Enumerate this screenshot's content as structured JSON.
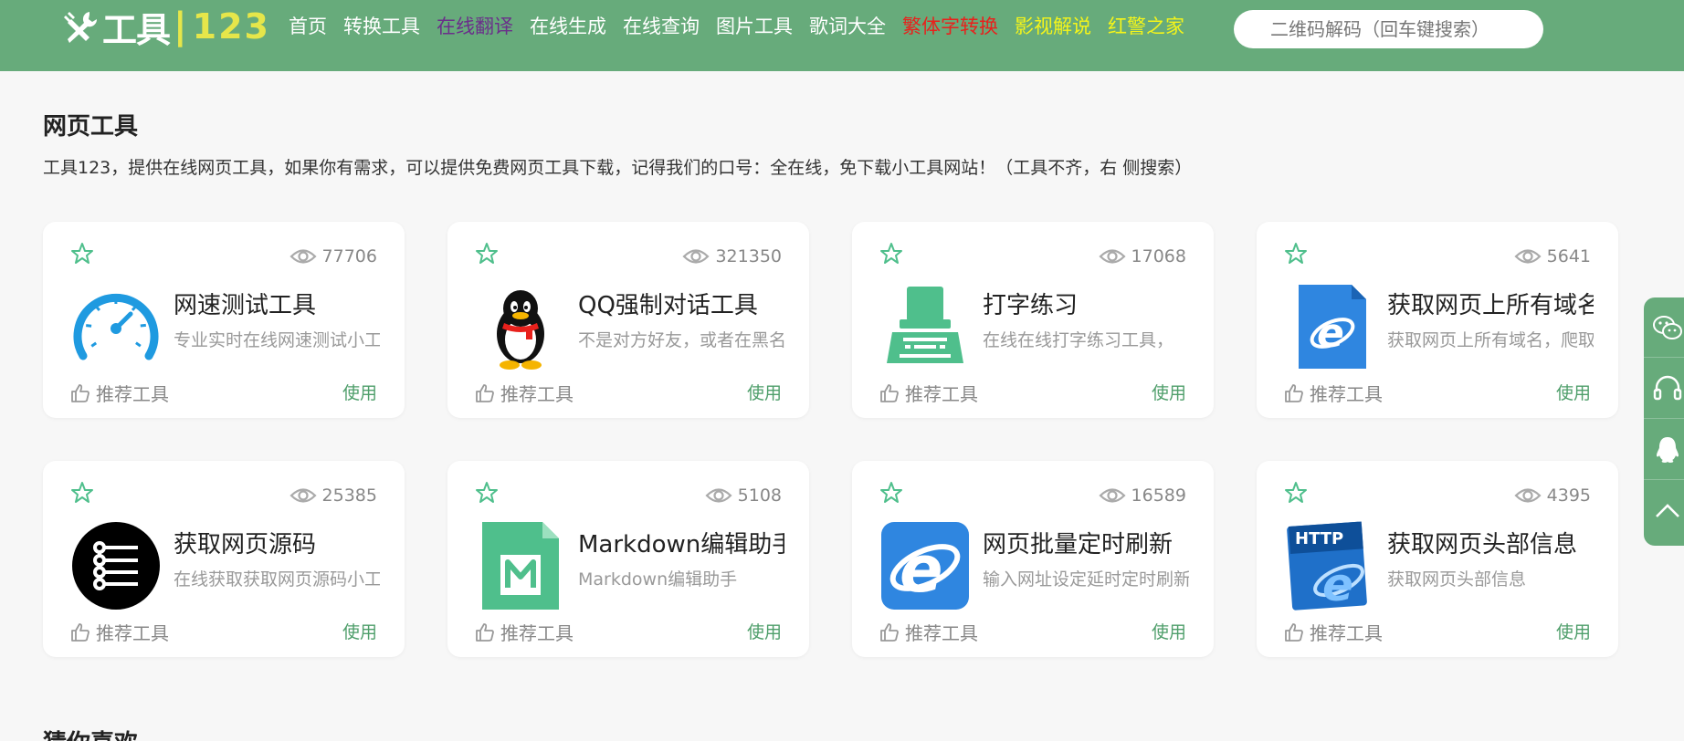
{
  "header": {
    "logo_text": "工具",
    "logo_sep": "|",
    "logo_num": "123",
    "nav": [
      {
        "label": "首页",
        "color": "#ffffff"
      },
      {
        "label": "转换工具",
        "color": "#ffffff"
      },
      {
        "label": "在线翻译",
        "color": "#6a2f8a"
      },
      {
        "label": "在线生成",
        "color": "#ffffff"
      },
      {
        "label": "在线查询",
        "color": "#ffffff"
      },
      {
        "label": "图片工具",
        "color": "#ffffff"
      },
      {
        "label": "歌词大全",
        "color": "#ffffff"
      },
      {
        "label": "繁体字转换",
        "color": "#e8211c"
      },
      {
        "label": "影视解说",
        "color": "#f5f51a"
      },
      {
        "label": "红警之家",
        "color": "#f5f51a"
      }
    ],
    "search_placeholder": "二维码解码（回车键搜索）"
  },
  "section": {
    "title": "网页工具",
    "desc": "工具123，提供在线网页工具，如果你有需求，可以提供免费网页工具下载，记得我们的口号：全在线，免下载小工具网站！（工具不齐，右 侧搜索）"
  },
  "cards": [
    {
      "views": "77706",
      "icon": "speedometer-icon",
      "name": "网速测试工具",
      "desc": "专业实时在线网速测试小工具",
      "rec": "推荐工具",
      "use": "使用"
    },
    {
      "views": "321350",
      "icon": "qq-penguin-icon",
      "name": "QQ强制对话工具",
      "desc": "不是对方好友，或者在黑名单中",
      "rec": "推荐工具",
      "use": "使用"
    },
    {
      "views": "17068",
      "icon": "typewriter-icon",
      "name": "打字练习",
      "desc": "在线在线打字练习工具，",
      "rec": "推荐工具",
      "use": "使用"
    },
    {
      "views": "5641",
      "icon": "ie-file-icon",
      "name": "获取网页上所有域名",
      "desc": "获取网页上所有域名，爬取",
      "rec": "推荐工具",
      "use": "使用"
    },
    {
      "views": "25385",
      "icon": "source-tree-icon",
      "name": "获取网页源码",
      "desc": "在线获取获取网页源码小工具",
      "rec": "推荐工具",
      "use": "使用"
    },
    {
      "views": "5108",
      "icon": "markdown-file-icon",
      "name": "Markdown编辑助手",
      "desc": "Markdown编辑助手",
      "rec": "推荐工具",
      "use": "使用"
    },
    {
      "views": "16589",
      "icon": "ie-browser-icon",
      "name": "网页批量定时刷新",
      "desc": "输入网址设定延时定时刷新",
      "rec": "推荐工具",
      "use": "使用"
    },
    {
      "views": "4395",
      "icon": "http-ie-icon",
      "name": "获取网页头部信息",
      "desc": "获取网页头部信息",
      "rec": "推荐工具",
      "use": "使用"
    }
  ],
  "next_section_title": "猜你喜欢",
  "colors": {
    "brand": "#67ab7b",
    "accent": "#4e9e6a",
    "logo_yellow": "#e6e64a"
  }
}
